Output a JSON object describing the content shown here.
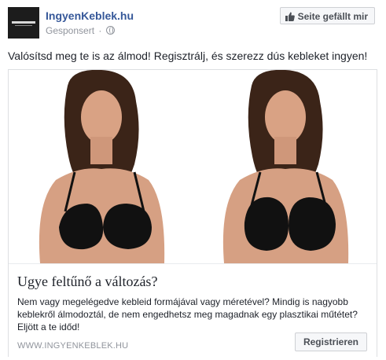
{
  "header": {
    "page_name": "IngyenKeblek.hu",
    "sponsored": "Gesponsert",
    "separator": "·",
    "like_label": "Seite gefällt mir"
  },
  "post": {
    "text": "Valósítsd meg te is az álmod! Regisztrálj, és szerezz dús kebleket ingyen!"
  },
  "card": {
    "title": "Ugye feltűnő a változás?",
    "description": "Nem vagy megelégedve kebleid formájával vagy méretével? Mindig is nagyobb keblekről álmodoztál, de nem engedhetsz meg magadnak egy plasztikai műtétet? Eljött a te időd!",
    "domain": "WWW.INGYENKEBLEK.HU",
    "cta_label": "Registrieren"
  },
  "colors": {
    "link_blue": "#365899",
    "meta_gray": "#90949c",
    "border": "#dddfe2"
  }
}
